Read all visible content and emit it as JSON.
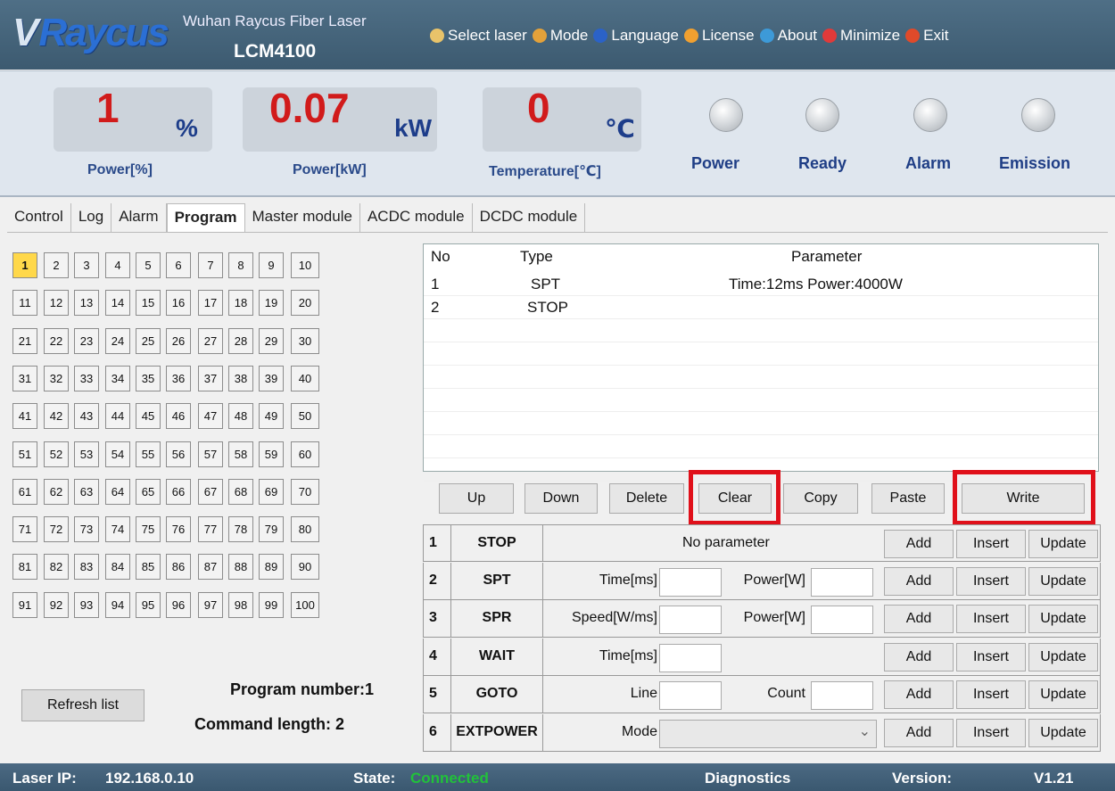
{
  "header": {
    "logo": "Raycus",
    "company": "Wuhan Raycus Fiber Laser",
    "model": "LCM4100",
    "menu": [
      {
        "label": "Select laser",
        "icon": "laser-icon",
        "color": "#e8c36a"
      },
      {
        "label": "Mode",
        "icon": "users-icon",
        "color": "#e3a13a"
      },
      {
        "label": "Language",
        "icon": "language-icon",
        "color": "#2b62c7"
      },
      {
        "label": "License",
        "icon": "license-icon",
        "color": "#f0a030"
      },
      {
        "label": "About",
        "icon": "about-icon",
        "color": "#3d9ad8"
      },
      {
        "label": "Minimize",
        "icon": "minimize-icon",
        "color": "#e03a3a"
      },
      {
        "label": "Exit",
        "icon": "close-icon",
        "color": "#e04a2a"
      }
    ]
  },
  "gauges": [
    {
      "value": "1",
      "unit": "%",
      "label": "Power[%]"
    },
    {
      "value": "0.07",
      "unit": "kW",
      "label": "Power[kW]"
    },
    {
      "value": "0",
      "unit": "℃",
      "label": "Temperature[℃]"
    }
  ],
  "leds": [
    {
      "label": "Power"
    },
    {
      "label": "Ready"
    },
    {
      "label": "Alarm"
    },
    {
      "label": "Emission"
    }
  ],
  "tabs": [
    "Control",
    "Log",
    "Alarm",
    "Program",
    "Master module",
    "ACDC module",
    "DCDC module"
  ],
  "active_tab": "Program",
  "program_numbers": [
    "1",
    "2",
    "3",
    "4",
    "5",
    "6",
    "7",
    "8",
    "9",
    "10",
    "11",
    "12",
    "13",
    "14",
    "15",
    "16",
    "17",
    "18",
    "19",
    "20",
    "21",
    "22",
    "23",
    "24",
    "25",
    "26",
    "27",
    "28",
    "29",
    "30",
    "31",
    "32",
    "33",
    "34",
    "35",
    "36",
    "37",
    "38",
    "39",
    "40",
    "41",
    "42",
    "43",
    "44",
    "45",
    "46",
    "47",
    "48",
    "49",
    "50",
    "51",
    "52",
    "53",
    "54",
    "55",
    "56",
    "57",
    "58",
    "59",
    "60",
    "61",
    "62",
    "63",
    "64",
    "65",
    "66",
    "67",
    "68",
    "69",
    "70",
    "71",
    "72",
    "73",
    "74",
    "75",
    "76",
    "77",
    "78",
    "79",
    "80",
    "81",
    "82",
    "83",
    "84",
    "85",
    "86",
    "87",
    "88",
    "89",
    "90",
    "91",
    "92",
    "93",
    "94",
    "95",
    "96",
    "97",
    "98",
    "99",
    "100"
  ],
  "selected_program": "1",
  "refresh_label": "Refresh list",
  "program_number_text": "Program number:1",
  "command_length_text": "Command length:  2",
  "list": {
    "headers": {
      "no": "No",
      "type": "Type",
      "param": "Parameter"
    },
    "rows": [
      {
        "no": "1",
        "type": "SPT",
        "param": "Time:12ms Power:4000W"
      },
      {
        "no": "2",
        "type": "STOP",
        "param": ""
      }
    ]
  },
  "buttons": {
    "up": "Up",
    "down": "Down",
    "delete": "Delete",
    "clear": "Clear",
    "copy": "Copy",
    "paste": "Paste",
    "write": "Write"
  },
  "commands": [
    {
      "n": "1",
      "type": "STOP",
      "note": "No parameter"
    },
    {
      "n": "2",
      "type": "SPT",
      "l1": "Time[ms]",
      "l2": "Power[W]"
    },
    {
      "n": "3",
      "type": "SPR",
      "l1": "Speed[W/ms]",
      "l2": "Power[W]"
    },
    {
      "n": "4",
      "type": "WAIT",
      "l1": "Time[ms]"
    },
    {
      "n": "5",
      "type": "GOTO",
      "l1": "Line",
      "l2": "Count"
    },
    {
      "n": "6",
      "type": "EXTPOWER",
      "l1": "Mode"
    }
  ],
  "cmd_buttons": {
    "add": "Add",
    "insert": "Insert",
    "update": "Update"
  },
  "footer": {
    "ip_label": "Laser IP:",
    "ip": "192.168.0.10",
    "state_label": "State:",
    "state": "Connected",
    "state_color": "#21c23a",
    "diag": "Diagnostics",
    "version_label": "Version:",
    "version": "V1.21"
  }
}
